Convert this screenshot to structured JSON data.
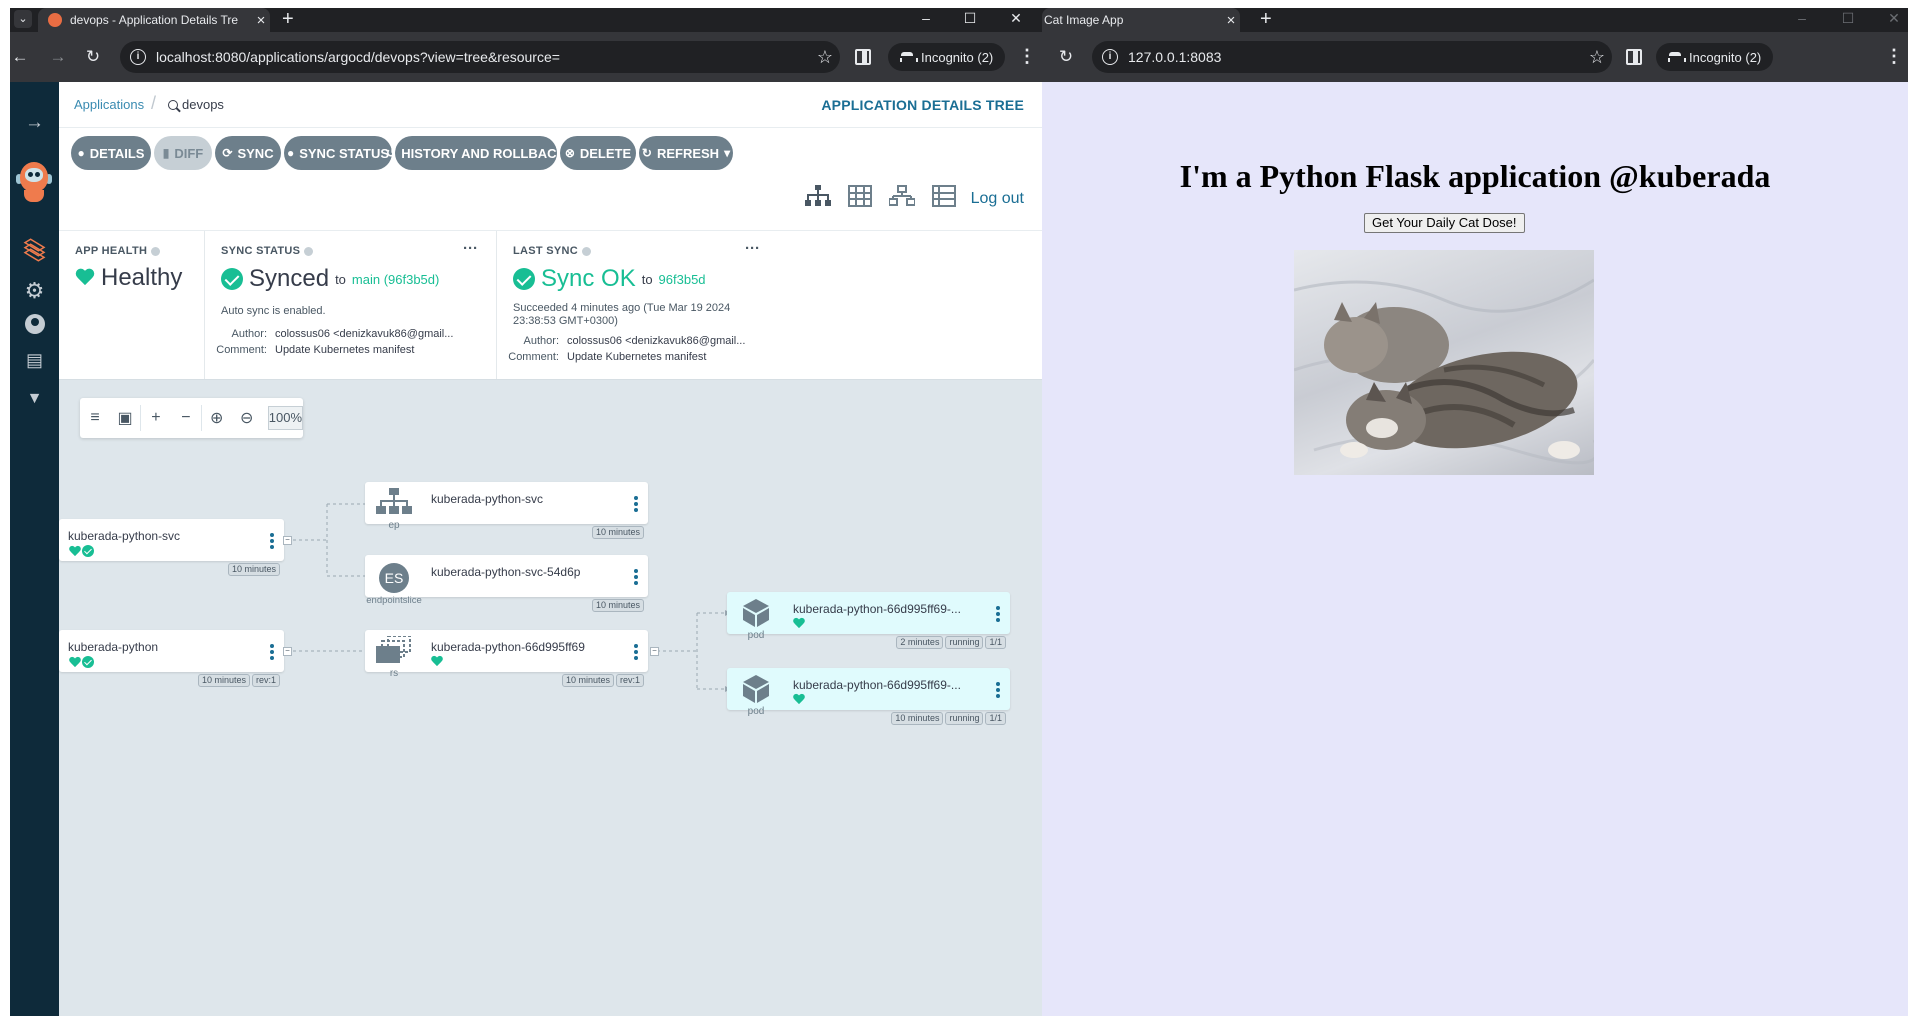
{
  "left_window": {
    "tab_title": "devops - Application Details Tre",
    "url": "localhost:8080/applications/argocd/devops?view=tree&resource=",
    "incognito_label": "Incognito (2)"
  },
  "right_window": {
    "tab_title": "Cat Image App",
    "url": "127.0.0.1:8083",
    "incognito_label": "Incognito (2)"
  },
  "argocd": {
    "breadcrumb": {
      "root": "Applications",
      "current": "devops"
    },
    "page_title": "APPLICATION DETAILS TREE",
    "actions": [
      {
        "label": "DETAILS",
        "icon": "info-icon",
        "disabled": false
      },
      {
        "label": "DIFF",
        "icon": "diff-icon",
        "disabled": true
      },
      {
        "label": "SYNC",
        "icon": "sync-icon",
        "disabled": false
      },
      {
        "label": "SYNC STATUS",
        "icon": "info-icon",
        "disabled": false
      },
      {
        "label": "HISTORY AND ROLLBACK",
        "icon": "history-icon",
        "disabled": false
      },
      {
        "label": "DELETE",
        "icon": "delete-icon",
        "disabled": false
      },
      {
        "label": "REFRESH",
        "icon": "refresh-icon",
        "disabled": false
      }
    ],
    "logout_label": "Log out",
    "app_health": {
      "label": "APP HEALTH",
      "value": "Healthy"
    },
    "sync_status": {
      "label": "SYNC STATUS",
      "value": "Synced",
      "to_label": "to",
      "revision": "main (96f3b5d)",
      "note": "Auto sync is enabled.",
      "author_label": "Author:",
      "author": "colossus06 <denizkavuk86@gmail...",
      "comment_label": "Comment:",
      "comment": "Update Kubernetes manifest"
    },
    "last_sync": {
      "label": "LAST SYNC",
      "value": "Sync OK",
      "to_label": "to",
      "revision": "96f3b5d",
      "note_line1": "Succeeded 4 minutes ago (Tue Mar 19 2024",
      "note_line2": "23:38:53 GMT+0300)",
      "author_label": "Author:",
      "author": "colossus06 <denizkavuk86@gmail...",
      "comment_label": "Comment:",
      "comment": "Update Kubernetes manifest"
    },
    "zoom_level": "100%",
    "nodes": {
      "svc_app": {
        "name": "kuberada-python-svc",
        "age": "10 minutes"
      },
      "ep": {
        "name": "kuberada-python-svc",
        "kind": "ep",
        "age": "10 minutes"
      },
      "es": {
        "name": "kuberada-python-svc-54d6p",
        "kind": "endpointslice",
        "badge": "ES",
        "age": "10 minutes"
      },
      "deploy_app": {
        "name": "kuberada-python",
        "age": "10 minutes",
        "rev": "rev:1"
      },
      "rs": {
        "name": "kuberada-python-66d995ff69",
        "kind": "rs",
        "age": "10 minutes",
        "rev": "rev:1"
      },
      "pod1": {
        "name": "kuberada-python-66d995ff69-...",
        "kind": "pod",
        "age": "2 minutes",
        "status": "running",
        "ready": "1/1"
      },
      "pod2": {
        "name": "kuberada-python-66d995ff69-...",
        "kind": "pod",
        "age": "10 minutes",
        "status": "running",
        "ready": "1/1"
      }
    }
  },
  "flask": {
    "heading": "I'm a Python Flask application @kuberada",
    "button_label": "Get Your Daily Cat Dose!"
  },
  "colors": {
    "argo_nav": "#0e2a3a",
    "argo_link": "#1a6e94",
    "healthy_green": "#18be94",
    "action_button": "#6d7f8b",
    "flask_bg": "#e6e6fa"
  }
}
